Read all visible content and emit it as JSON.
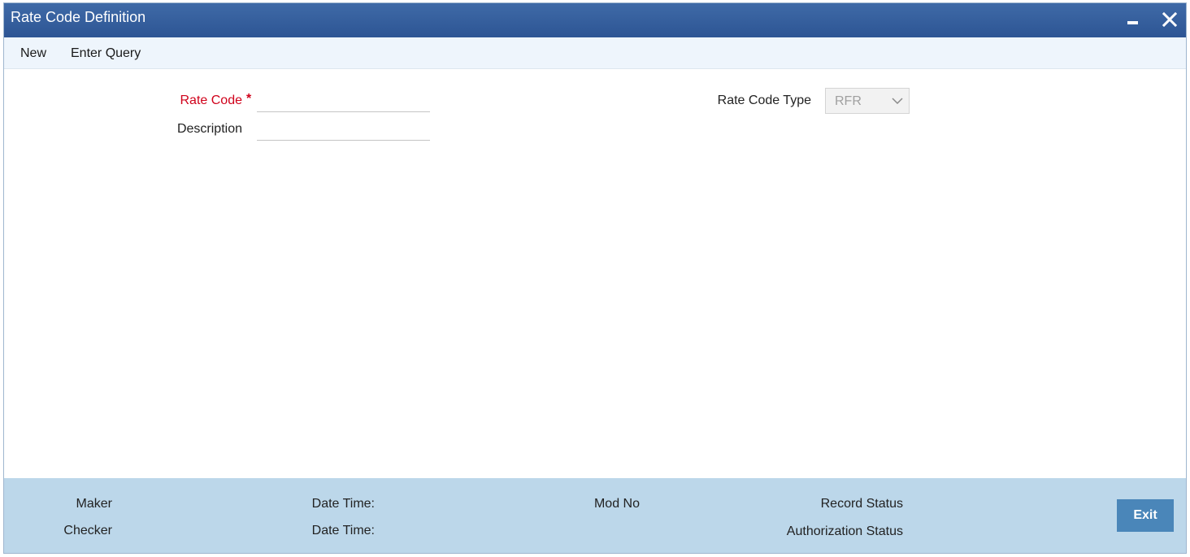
{
  "window": {
    "title": "Rate Code Definition",
    "minimize_icon": "minimize-icon",
    "close_icon": "close-icon"
  },
  "toolbar": {
    "new_label": "New",
    "enter_query_label": "Enter Query"
  },
  "form": {
    "rate_code_label": "Rate Code",
    "required_marker": "*",
    "rate_code_value": "",
    "description_label": "Description",
    "description_value": "",
    "rate_code_type_label": "Rate Code Type",
    "rate_code_type_value": "RFR"
  },
  "footer": {
    "maker_label": "Maker",
    "checker_label": "Checker",
    "date_time_label_1": "Date Time:",
    "date_time_label_2": "Date Time:",
    "mod_no_label": "Mod No",
    "record_status_label": "Record Status",
    "authorization_status_label": "Authorization Status",
    "exit_label": "Exit"
  },
  "colors": {
    "titlebar": "#2d5594",
    "toolbar_bg": "#eef5fc",
    "footer_bg": "#bcd7ea",
    "required_red": "#d0021b",
    "exit_button": "#4a86b9"
  }
}
